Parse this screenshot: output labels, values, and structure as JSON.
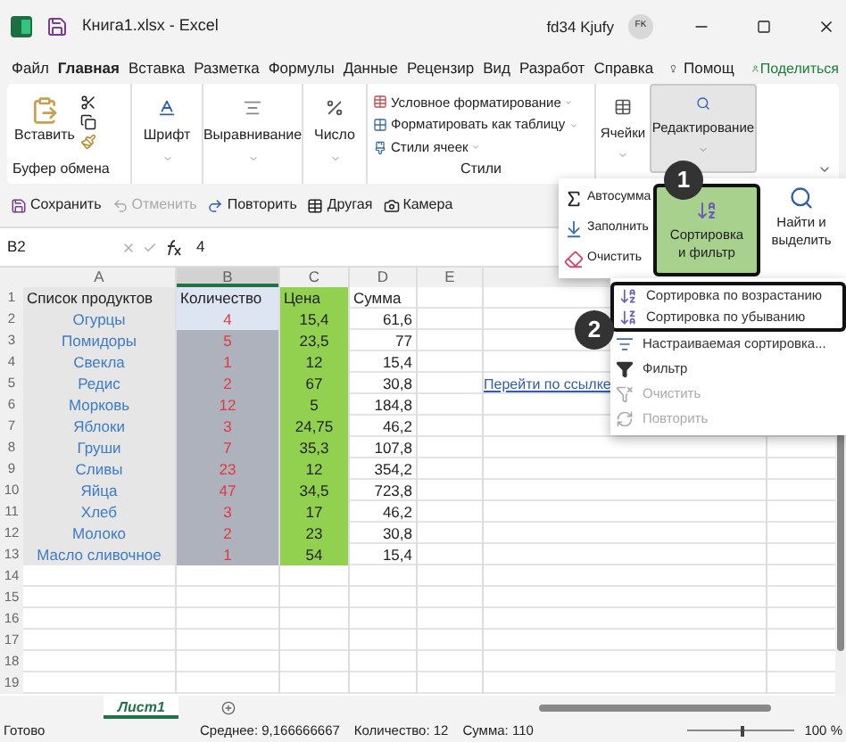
{
  "title_bar": {
    "title": "Книга1.xlsx - Excel",
    "user": "fd34 Kjufy",
    "avatar": "FK"
  },
  "menu_tabs": [
    {
      "label": "Файл",
      "selected": false
    },
    {
      "label": "Главная",
      "selected": true
    },
    {
      "label": "Вставка",
      "selected": false
    },
    {
      "label": "Разметка",
      "selected": false
    },
    {
      "label": "Формулы",
      "selected": false
    },
    {
      "label": "Данные",
      "selected": false
    },
    {
      "label": "Рецензир",
      "selected": false
    },
    {
      "label": "Вид",
      "selected": false
    },
    {
      "label": "Разработ",
      "selected": false
    },
    {
      "label": "Справка",
      "selected": false
    }
  ],
  "help": "Помощ",
  "share": "Поделиться",
  "ribbon": {
    "paste": "Вставить",
    "clipboard_group": "Буфер обмена",
    "font": "Шрифт",
    "alignment": "Выравнивание",
    "number": "Число",
    "styles": [
      "Условное форматирование",
      "Форматировать как таблицу",
      "Стили ячеек"
    ],
    "styles_group": "Стили",
    "cells": "Ячейки",
    "editing": {
      "label": "Редактирование",
      "selected": true
    }
  },
  "quick_access": [
    {
      "label": "Сохранить",
      "disabled": false
    },
    {
      "label": "Отменить",
      "disabled": true
    },
    {
      "label": "Повторить",
      "disabled": false
    },
    {
      "label": "Другая",
      "disabled": false
    },
    {
      "label": "Камера",
      "disabled": false
    }
  ],
  "formula_bar": {
    "name_box": "B2",
    "value": "4"
  },
  "grid": {
    "columns": [
      {
        "label": "A",
        "selected": false
      },
      {
        "label": "B",
        "selected": true
      },
      {
        "label": "C",
        "selected": false
      },
      {
        "label": "D",
        "selected": false
      },
      {
        "label": "E",
        "selected": false
      }
    ],
    "header": [
      "Список продуктов",
      "Количество",
      "Цена",
      "Сумма"
    ],
    "rows": [
      [
        "Огурцы",
        "4",
        "15,4",
        "61,6"
      ],
      [
        "Помидоры",
        "5",
        "23,5",
        "77"
      ],
      [
        "Свекла",
        "1",
        "12",
        "15,4"
      ],
      [
        "Редис",
        "2",
        "67",
        "30,8"
      ],
      [
        "Морковь",
        "12",
        "5",
        "184,8"
      ],
      [
        "Яблоки",
        "3",
        "24,75",
        "46,2"
      ],
      [
        "Груши",
        "7",
        "35,3",
        "107,8"
      ],
      [
        "Сливы",
        "23",
        "12",
        "354,2"
      ],
      [
        "Яйца",
        "47",
        "34,5",
        "723,8"
      ],
      [
        "Хлеб",
        "3",
        "17",
        "46,2"
      ],
      [
        "Молоко",
        "2",
        "23",
        "30,8"
      ],
      [
        "Масло сливочное",
        "1",
        "54",
        "15,4"
      ]
    ],
    "row_numbers": [
      "1",
      "2",
      "3",
      "4",
      "5",
      "6",
      "7",
      "8",
      "9",
      "10",
      "11",
      "12",
      "13",
      "14",
      "15",
      "16",
      "17",
      "18",
      "19"
    ],
    "link": "Перейти по ссылке"
  },
  "editing_menu": {
    "items": [
      {
        "label": "Автосумма",
        "kind": "sum"
      },
      {
        "label": "Заполнить",
        "kind": "fill"
      },
      {
        "label": "Очистить",
        "kind": "clear"
      }
    ],
    "sort": {
      "line1": "Сортировка",
      "line2": "и фильтр",
      "selected": true
    },
    "find": {
      "line1": "Найти и",
      "line2": "выделить"
    }
  },
  "sort_menu": [
    {
      "label": "Сортировка по возрастанию",
      "kind": "asc",
      "disabled": false,
      "highlighted": true
    },
    {
      "label": "Сортировка по убыванию",
      "kind": "desc",
      "disabled": false,
      "highlighted": true
    },
    {
      "label": "Настраиваемая сортировка...",
      "kind": "custom",
      "disabled": false,
      "highlighted": false
    },
    {
      "label": "Фильтр",
      "kind": "filter",
      "disabled": false,
      "highlighted": false
    },
    {
      "label": "Очистить",
      "kind": "clear",
      "disabled": true,
      "highlighted": false
    },
    {
      "label": "Повторить",
      "kind": "reapply",
      "disabled": true,
      "highlighted": false
    }
  ],
  "callouts": [
    "1",
    "2"
  ],
  "sheet_tabs": [
    {
      "label": "Лист1",
      "selected": true
    }
  ],
  "status_bar": {
    "state": "Готово",
    "average": "Среднее: 9,166666667",
    "count": "Количество: 12",
    "sum": "Сумма: 110",
    "zoom": "100 %",
    "zoom_level": {
      "level": 0.5
    }
  }
}
